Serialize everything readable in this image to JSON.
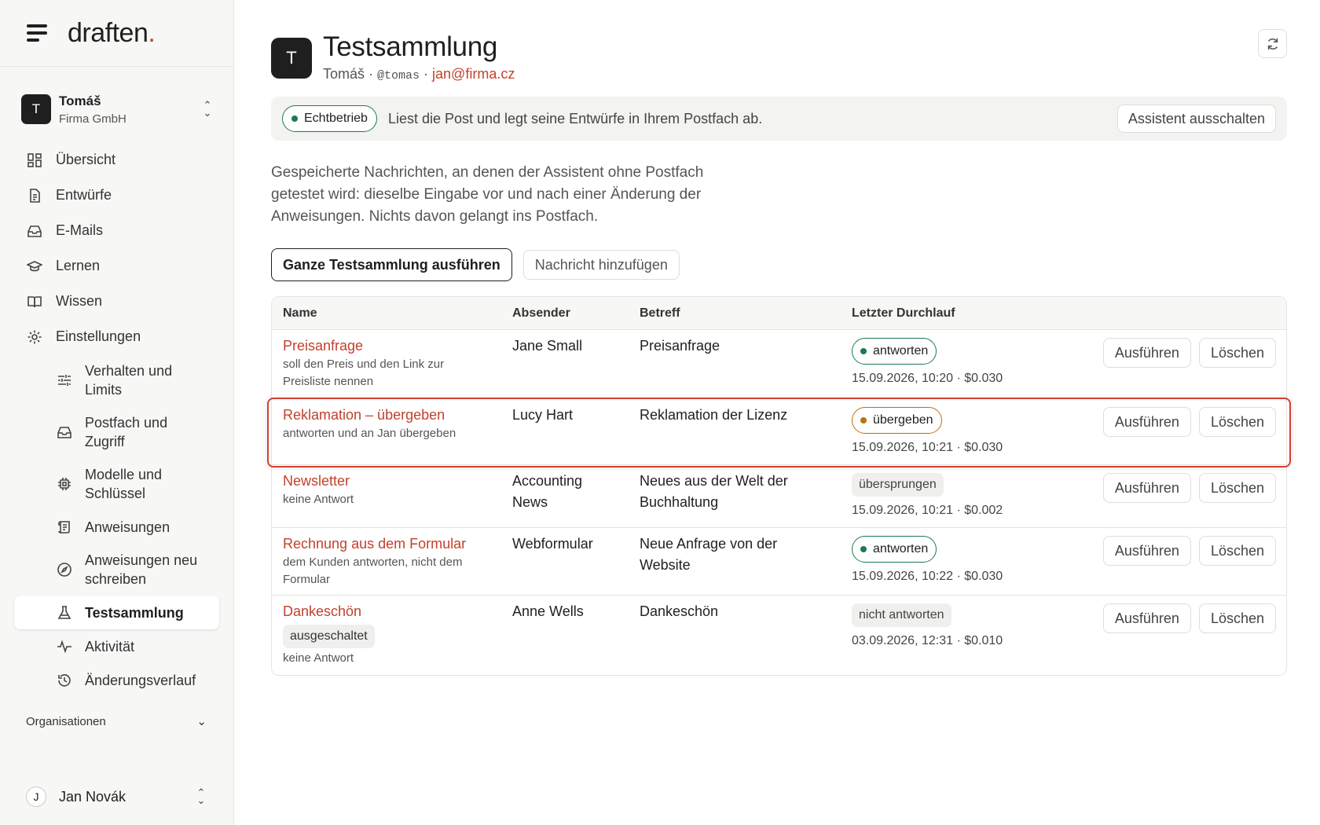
{
  "brand": {
    "logo_text": "draften",
    "logo_dot": "."
  },
  "account": {
    "initial": "T",
    "name": "Tomáš",
    "org": "Firma GmbH"
  },
  "nav": {
    "overview": "Übersicht",
    "drafts": "Entwürfe",
    "emails": "E-Mails",
    "learn": "Lernen",
    "knowledge": "Wissen",
    "settings": "Einstellungen"
  },
  "subnav": {
    "behavior": "Verhalten und Limits",
    "mailbox": "Postfach und Zugriff",
    "models": "Modelle und Schlüssel",
    "instructions": "Anweisungen",
    "rewrite": "Anweisungen neu schreiben",
    "testsuite": "Testsammlung",
    "activity": "Aktivität",
    "history": "Änderungsverlauf"
  },
  "organisations_label": "Organisationen",
  "user": {
    "initial": "J",
    "name": "Jan Novák"
  },
  "page": {
    "avatar_initial": "T",
    "title": "Testsammlung",
    "name": "Tomáš",
    "sep1": " · ",
    "handle": "@tomas",
    "sep2": " · ",
    "email": "jan@firma.cz"
  },
  "status": {
    "badge": "Echtbetrieb",
    "text": "Liest die Post und legt seine Entwürfe in Ihrem Postfach ab.",
    "disable_button": "Assistent ausschalten"
  },
  "description": "Gespeicherte Nachrichten, an denen der Assistent ohne Postfach getestet wird: dieselbe Eingabe vor und nach einer Änderung der Anweisungen. Nichts davon gelangt ins Postfach.",
  "actions": {
    "run_all": "Ganze Testsammlung ausführen",
    "add_message": "Nachricht hinzufügen"
  },
  "table": {
    "headers": {
      "name": "Name",
      "sender": "Absender",
      "subject": "Betreff",
      "last_run": "Letzter Durchlauf"
    },
    "run_label": "Ausführen",
    "delete_label": "Löschen",
    "rows": [
      {
        "name": "Preisanfrage",
        "note": "soll den Preis und den Link zur Preisliste nennen",
        "tag": "",
        "sender": "Jane Small",
        "subject": "Preisanfrage",
        "status": "antworten",
        "status_color": "#1f7a4d",
        "meta": "15.09.2026, 10:20 · $0.030"
      },
      {
        "name": "Reklamation – übergeben",
        "note": "antworten und an Jan übergeben",
        "tag": "",
        "sender": "Lucy Hart",
        "subject": "Reklamation der Lizenz",
        "status": "übergeben",
        "status_color": "#b8730a",
        "meta": "15.09.2026, 10:21 · $0.030"
      },
      {
        "name": "Newsletter",
        "note": "keine Antwort",
        "tag": "",
        "sender": "Accounting News",
        "subject": "Neues aus der Welt der Buchhaltung",
        "status": "übersprungen",
        "status_color": "#efefed",
        "meta": "15.09.2026, 10:21 · $0.002"
      },
      {
        "name": "Rechnung aus dem Formular",
        "note": "dem Kunden antworten, nicht dem Formular",
        "tag": "",
        "sender": "Webformular",
        "subject": "Neue Anfrage von der Website",
        "status": "antworten",
        "status_color": "#1f7a4d",
        "meta": "15.09.2026, 10:22 · $0.030"
      },
      {
        "name": "Dankeschön",
        "note": "keine Antwort",
        "tag": "ausgeschaltet",
        "sender": "Anne Wells",
        "subject": "Dankeschön",
        "status": "nicht antworten",
        "status_color": "#efefed",
        "meta": "03.09.2026, 12:31 · $0.010"
      }
    ]
  }
}
